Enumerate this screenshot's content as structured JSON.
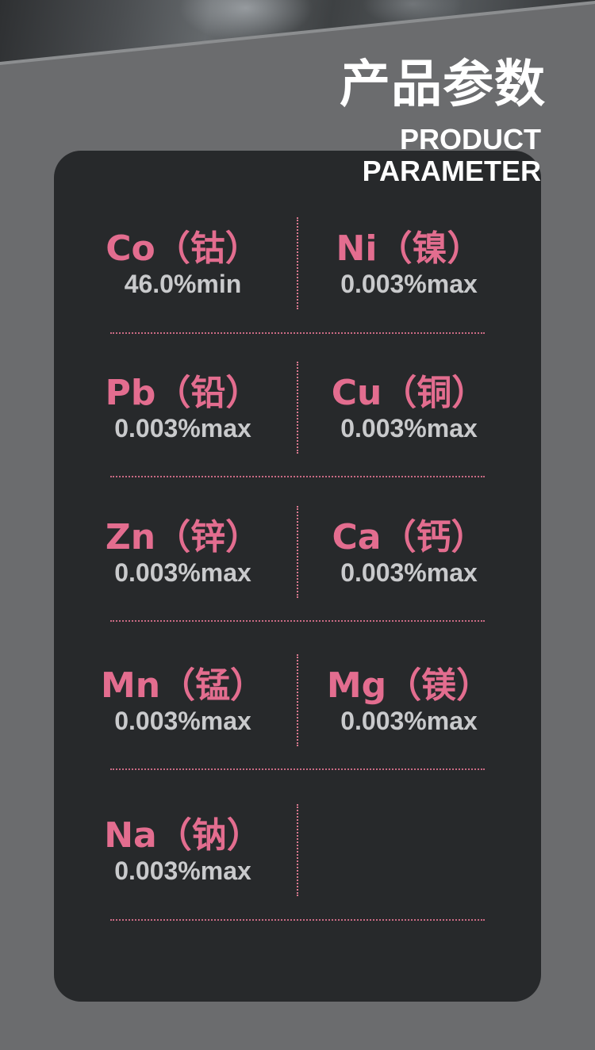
{
  "header": {
    "title_cn": "产品参数",
    "title_en_line1": "PRODUCT",
    "title_en_line2": "PARAMETER"
  },
  "colors": {
    "background": "#6b6c6e",
    "card": "#27292b",
    "element_name": "#e36d8f",
    "element_value": "#c9cacc",
    "divider": "#d9798f"
  },
  "parameters": [
    {
      "name": "Co（钴）",
      "value": "46.0%min"
    },
    {
      "name": "Ni（镍）",
      "value": "0.003%max"
    },
    {
      "name": "Pb（铅）",
      "value": "0.003%max"
    },
    {
      "name": "Cu（铜）",
      "value": "0.003%max"
    },
    {
      "name": "Zn（锌）",
      "value": "0.003%max"
    },
    {
      "name": "Ca（钙）",
      "value": "0.003%max"
    },
    {
      "name": "Mn（锰）",
      "value": "0.003%max"
    },
    {
      "name": "Mg（镁）",
      "value": "0.003%max"
    },
    {
      "name": "Na（钠）",
      "value": "0.003%max"
    }
  ]
}
